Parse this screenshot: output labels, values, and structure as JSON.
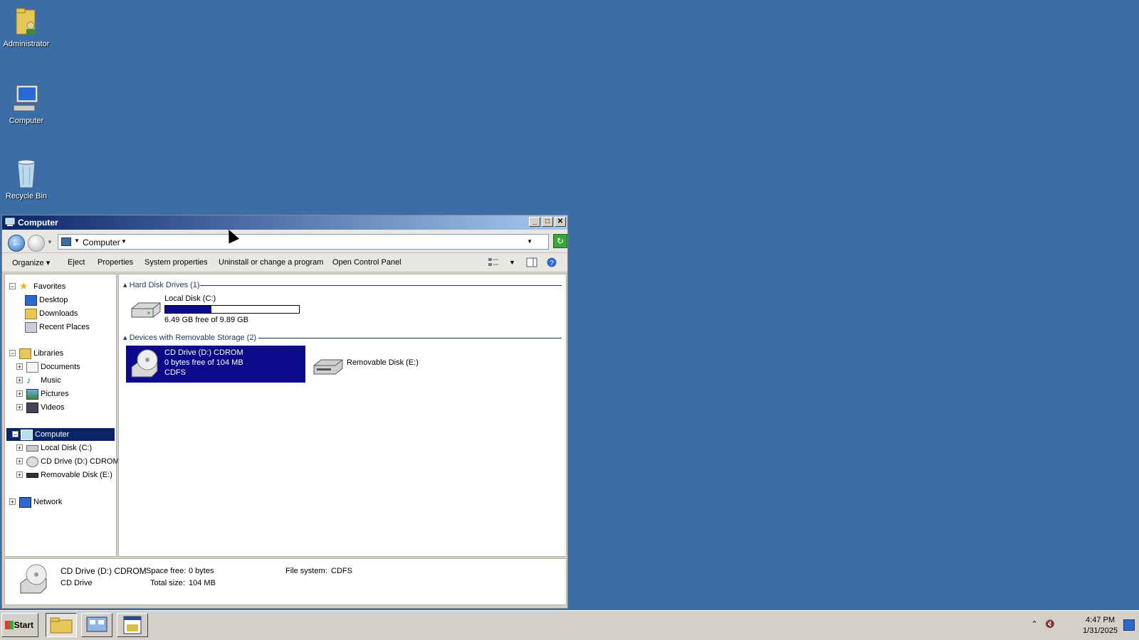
{
  "desktop": {
    "icons": [
      {
        "label": "Administrator",
        "icon": "user-folder-icon"
      },
      {
        "label": "Computer",
        "icon": "computer-icon"
      },
      {
        "label": "Recycle Bin",
        "icon": "recycle-bin-icon"
      }
    ]
  },
  "window": {
    "title": "Computer",
    "address": {
      "crumb": "Computer"
    },
    "toolbar": {
      "organize": "Organize",
      "eject": "Eject",
      "properties": "Properties",
      "system_properties": "System properties",
      "uninstall": "Uninstall or change a program",
      "control_panel": "Open Control Panel"
    },
    "nav": {
      "favorites": "Favorites",
      "desktop": "Desktop",
      "downloads": "Downloads",
      "recent": "Recent Places",
      "libraries": "Libraries",
      "documents": "Documents",
      "music": "Music",
      "pictures": "Pictures",
      "videos": "Videos",
      "computer": "Computer",
      "local_disk": "Local Disk (C:)",
      "cd_drive": "CD Drive (D:) CDROM",
      "removable": "Removable Disk (E:)",
      "network": "Network"
    },
    "groups": {
      "hard_disks": "Hard Disk Drives (1)",
      "removable": "Devices with Removable Storage (2)"
    },
    "drives": {
      "c": {
        "name": "Local Disk (C:)",
        "free_text": "6.49 GB free of 9.89 GB",
        "used_fraction": 0.344
      },
      "d": {
        "name": "CD Drive (D:) CDROM",
        "free_text": "0 bytes free of 104 MB",
        "fs": "CDFS"
      },
      "e": {
        "name": "Removable Disk (E:)"
      }
    },
    "details": {
      "name": "CD Drive (D:) CDROM",
      "type": "CD Drive",
      "space_free_label": "Space free:",
      "space_free": "0 bytes",
      "total_size_label": "Total size:",
      "total_size": "104 MB",
      "fs_label": "File system:",
      "fs": "CDFS"
    }
  },
  "taskbar": {
    "start": "Start",
    "time": "4:47 PM",
    "date": "1/31/2025"
  },
  "colors": {
    "desktop": "#3a6ea5",
    "selection": "#0a0a8a"
  }
}
